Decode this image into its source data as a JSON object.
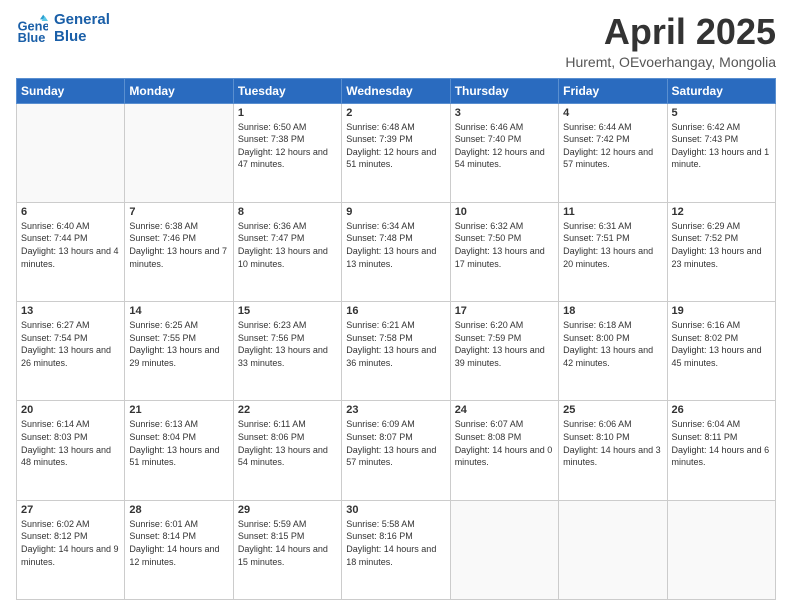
{
  "header": {
    "logo_line1": "General",
    "logo_line2": "Blue",
    "title": "April 2025",
    "subtitle": "Huremt, OEvoerhangay, Mongolia"
  },
  "weekdays": [
    "Sunday",
    "Monday",
    "Tuesday",
    "Wednesday",
    "Thursday",
    "Friday",
    "Saturday"
  ],
  "weeks": [
    [
      {
        "day": "",
        "info": ""
      },
      {
        "day": "",
        "info": ""
      },
      {
        "day": "1",
        "info": "Sunrise: 6:50 AM\nSunset: 7:38 PM\nDaylight: 12 hours and 47 minutes."
      },
      {
        "day": "2",
        "info": "Sunrise: 6:48 AM\nSunset: 7:39 PM\nDaylight: 12 hours and 51 minutes."
      },
      {
        "day": "3",
        "info": "Sunrise: 6:46 AM\nSunset: 7:40 PM\nDaylight: 12 hours and 54 minutes."
      },
      {
        "day": "4",
        "info": "Sunrise: 6:44 AM\nSunset: 7:42 PM\nDaylight: 12 hours and 57 minutes."
      },
      {
        "day": "5",
        "info": "Sunrise: 6:42 AM\nSunset: 7:43 PM\nDaylight: 13 hours and 1 minute."
      }
    ],
    [
      {
        "day": "6",
        "info": "Sunrise: 6:40 AM\nSunset: 7:44 PM\nDaylight: 13 hours and 4 minutes."
      },
      {
        "day": "7",
        "info": "Sunrise: 6:38 AM\nSunset: 7:46 PM\nDaylight: 13 hours and 7 minutes."
      },
      {
        "day": "8",
        "info": "Sunrise: 6:36 AM\nSunset: 7:47 PM\nDaylight: 13 hours and 10 minutes."
      },
      {
        "day": "9",
        "info": "Sunrise: 6:34 AM\nSunset: 7:48 PM\nDaylight: 13 hours and 13 minutes."
      },
      {
        "day": "10",
        "info": "Sunrise: 6:32 AM\nSunset: 7:50 PM\nDaylight: 13 hours and 17 minutes."
      },
      {
        "day": "11",
        "info": "Sunrise: 6:31 AM\nSunset: 7:51 PM\nDaylight: 13 hours and 20 minutes."
      },
      {
        "day": "12",
        "info": "Sunrise: 6:29 AM\nSunset: 7:52 PM\nDaylight: 13 hours and 23 minutes."
      }
    ],
    [
      {
        "day": "13",
        "info": "Sunrise: 6:27 AM\nSunset: 7:54 PM\nDaylight: 13 hours and 26 minutes."
      },
      {
        "day": "14",
        "info": "Sunrise: 6:25 AM\nSunset: 7:55 PM\nDaylight: 13 hours and 29 minutes."
      },
      {
        "day": "15",
        "info": "Sunrise: 6:23 AM\nSunset: 7:56 PM\nDaylight: 13 hours and 33 minutes."
      },
      {
        "day": "16",
        "info": "Sunrise: 6:21 AM\nSunset: 7:58 PM\nDaylight: 13 hours and 36 minutes."
      },
      {
        "day": "17",
        "info": "Sunrise: 6:20 AM\nSunset: 7:59 PM\nDaylight: 13 hours and 39 minutes."
      },
      {
        "day": "18",
        "info": "Sunrise: 6:18 AM\nSunset: 8:00 PM\nDaylight: 13 hours and 42 minutes."
      },
      {
        "day": "19",
        "info": "Sunrise: 6:16 AM\nSunset: 8:02 PM\nDaylight: 13 hours and 45 minutes."
      }
    ],
    [
      {
        "day": "20",
        "info": "Sunrise: 6:14 AM\nSunset: 8:03 PM\nDaylight: 13 hours and 48 minutes."
      },
      {
        "day": "21",
        "info": "Sunrise: 6:13 AM\nSunset: 8:04 PM\nDaylight: 13 hours and 51 minutes."
      },
      {
        "day": "22",
        "info": "Sunrise: 6:11 AM\nSunset: 8:06 PM\nDaylight: 13 hours and 54 minutes."
      },
      {
        "day": "23",
        "info": "Sunrise: 6:09 AM\nSunset: 8:07 PM\nDaylight: 13 hours and 57 minutes."
      },
      {
        "day": "24",
        "info": "Sunrise: 6:07 AM\nSunset: 8:08 PM\nDaylight: 14 hours and 0 minutes."
      },
      {
        "day": "25",
        "info": "Sunrise: 6:06 AM\nSunset: 8:10 PM\nDaylight: 14 hours and 3 minutes."
      },
      {
        "day": "26",
        "info": "Sunrise: 6:04 AM\nSunset: 8:11 PM\nDaylight: 14 hours and 6 minutes."
      }
    ],
    [
      {
        "day": "27",
        "info": "Sunrise: 6:02 AM\nSunset: 8:12 PM\nDaylight: 14 hours and 9 minutes."
      },
      {
        "day": "28",
        "info": "Sunrise: 6:01 AM\nSunset: 8:14 PM\nDaylight: 14 hours and 12 minutes."
      },
      {
        "day": "29",
        "info": "Sunrise: 5:59 AM\nSunset: 8:15 PM\nDaylight: 14 hours and 15 minutes."
      },
      {
        "day": "30",
        "info": "Sunrise: 5:58 AM\nSunset: 8:16 PM\nDaylight: 14 hours and 18 minutes."
      },
      {
        "day": "",
        "info": ""
      },
      {
        "day": "",
        "info": ""
      },
      {
        "day": "",
        "info": ""
      }
    ]
  ]
}
